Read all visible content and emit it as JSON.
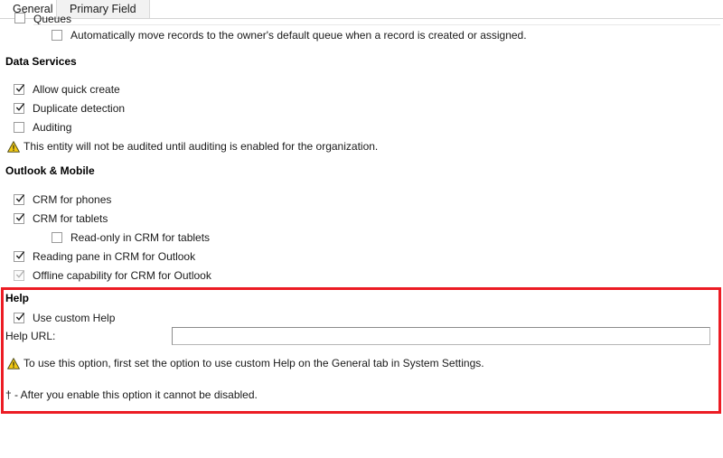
{
  "tabs": [
    {
      "label": "General",
      "active": true
    },
    {
      "label": "Primary Field",
      "active": false
    }
  ],
  "clipped_row": {
    "label": "Queues",
    "checked": false
  },
  "queues_row": {
    "label": "Automatically move records to the owner's default queue when a record is created or assigned.",
    "checked": false
  },
  "sections": {
    "data_services": {
      "heading": "Data Services",
      "items": [
        {
          "label": "Allow quick create",
          "checked": true,
          "disabled": false
        },
        {
          "label": "Duplicate detection",
          "checked": true,
          "disabled": false
        },
        {
          "label": "Auditing",
          "checked": false,
          "disabled": false
        }
      ],
      "warning": "This entity will not be audited until auditing is enabled for the organization."
    },
    "outlook_mobile": {
      "heading": "Outlook & Mobile",
      "items": [
        {
          "label": "CRM for phones",
          "checked": true,
          "disabled": false
        },
        {
          "label": "CRM for tablets",
          "checked": true,
          "disabled": false
        },
        {
          "label": "Read-only in CRM for tablets",
          "checked": false,
          "disabled": false
        },
        {
          "label": "Reading pane in CRM for Outlook",
          "checked": true,
          "disabled": false
        },
        {
          "label": "Offline capability for CRM for Outlook",
          "checked": true,
          "disabled": true
        }
      ]
    },
    "help": {
      "heading": "Help",
      "use_custom_help": {
        "label": "Use custom Help",
        "checked": true
      },
      "help_url": {
        "label": "Help URL:",
        "value": "",
        "placeholder": ""
      },
      "warning": "To use this option, first set the option to use custom Help on the General tab in System Settings.",
      "footnote": "† - After you enable this option it cannot be disabled."
    }
  },
  "icons": {
    "warning": "warning-triangle-icon",
    "checkmark": "check-icon"
  },
  "colors": {
    "highlight_border": "#ec1c24",
    "warning_fill": "#f2c811",
    "warning_stroke": "#4a4a20",
    "tab_inactive_bg": "#f2f2f2",
    "checkbox_border": "#9a9a9a"
  }
}
